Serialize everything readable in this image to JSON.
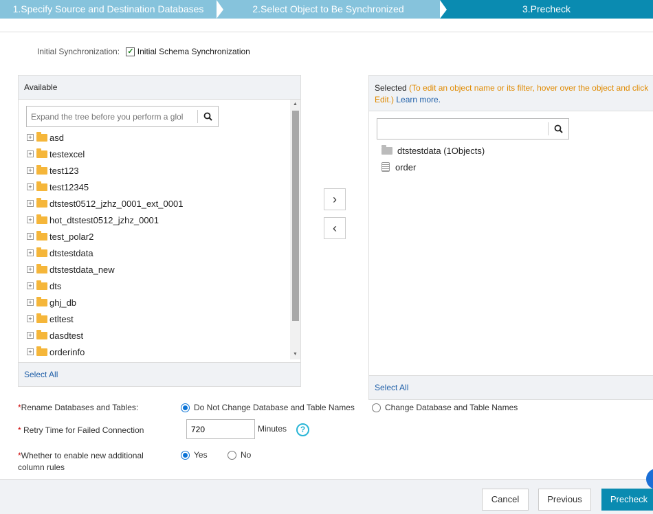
{
  "steps": [
    "1.Specify Source and Destination Databases",
    "2.Select Object to Be Synchronized",
    "3.Precheck"
  ],
  "init_sync": {
    "label": "Initial Synchronization:",
    "option": "Initial Schema Synchronization",
    "checked": true
  },
  "available": {
    "title": "Available",
    "search_placeholder": "Expand the tree before you perform a glol",
    "select_all": "Select All",
    "items": [
      "asd",
      "testexcel",
      "test123",
      "test12345",
      "dtstest0512_jzhz_0001_ext_0001",
      "hot_dtstest0512_jzhz_0001",
      "test_polar2",
      "dtstestdata",
      "dtstestdata_new",
      "dts",
      "ghj_db",
      "etltest",
      "dasdtest",
      "orderinfo"
    ]
  },
  "selected": {
    "title": "Selected",
    "hint": "(To edit an object name or its filter, hover over the object and click Edit.)",
    "learn_more": "Learn more.",
    "search_value": "",
    "db": "dtstestdata (1Objects)",
    "table": "order",
    "select_all": "Select All"
  },
  "move_right": "›",
  "move_left": "‹",
  "rename": {
    "label": "Rename Databases and Tables:",
    "opt1": "Do Not Change Database and Table Names",
    "opt2": "Change Database and Table Names",
    "selected": "opt1"
  },
  "retry": {
    "label": "Retry Time for Failed Connection",
    "value": "720",
    "unit": "Minutes",
    "help": "?"
  },
  "column_rules": {
    "label": "Whether to enable new additional column rules",
    "yes": "Yes",
    "no": "No",
    "selected": "yes"
  },
  "required_mark": "*",
  "buttons": {
    "cancel": "Cancel",
    "previous": "Previous",
    "precheck": "Precheck"
  },
  "colors": {
    "primary": "#0a8bb1",
    "step_inactive": "#86c3dc",
    "hint": "#e08a00",
    "link": "#1f5fa8"
  }
}
